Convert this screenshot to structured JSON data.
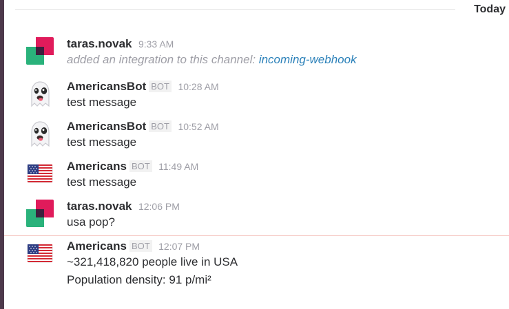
{
  "day_divider": {
    "label": "Today"
  },
  "messages": [
    {
      "author": "taras.novak",
      "time": "9:33 AM",
      "avatar": "taras-novak-avatar",
      "system_prefix": "added an integration to this channel: ",
      "system_link": "incoming-webhook"
    },
    {
      "author": "AmericansBot",
      "badge": "BOT",
      "time": "10:28 AM",
      "avatar": "ghost-emoji",
      "avatar_glyph": "👻",
      "lines": [
        "test message"
      ]
    },
    {
      "author": "AmericansBot",
      "badge": "BOT",
      "time": "10:52 AM",
      "avatar": "ghost-emoji",
      "avatar_glyph": "👻",
      "lines": [
        "test message"
      ]
    },
    {
      "author": "Americans",
      "badge": "BOT",
      "time": "11:49 AM",
      "avatar": "us-flag-emoji",
      "lines": [
        "test message"
      ]
    },
    {
      "author": "taras.novak",
      "time": "12:06 PM",
      "avatar": "taras-novak-avatar",
      "lines": [
        "usa pop?"
      ]
    },
    {
      "author": "Americans",
      "badge": "BOT",
      "time": "12:07 PM",
      "avatar": "us-flag-emoji",
      "lines": [
        "~321,418,820 people live in USA",
        "Population density: 91 p/mi²"
      ]
    }
  ],
  "colors": {
    "sidebar": "#4d394b",
    "link": "#2a80b9",
    "muted": "#9e9ea6",
    "unread_line": "#f5c7c2"
  }
}
